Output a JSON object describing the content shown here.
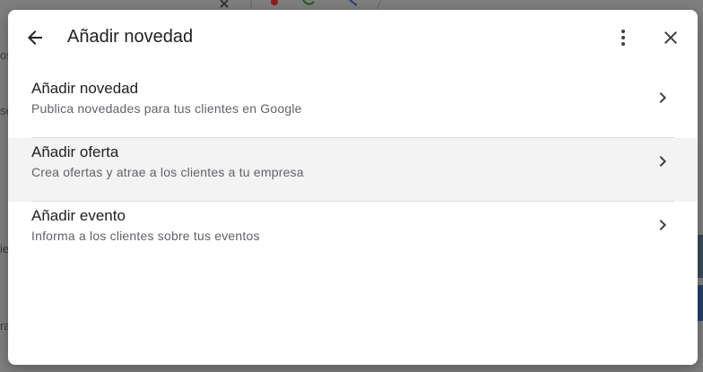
{
  "dialog": {
    "title": "Añadir novedad",
    "items": [
      {
        "title": "Añadir novedad",
        "subtitle": "Publica novedades para tus clientes en Google"
      },
      {
        "title": "Añadir oferta",
        "subtitle": "Crea ofertas y atrae a los clientes a tu empresa"
      },
      {
        "title": "Añadir evento",
        "subtitle": "Informa a los clientes sobre tus eventos"
      }
    ]
  },
  "background": {
    "fragments": [
      "os",
      "se",
      "ie",
      "ra"
    ]
  },
  "colors": {
    "text_primary": "#202124",
    "text_secondary": "#5f6368",
    "highlight": "#f3f3f3",
    "divider": "#dadce0"
  },
  "icons": {
    "back": "arrow-back-icon",
    "more": "more-vert-icon",
    "close": "close-icon",
    "chevron": "chevron-right-icon"
  }
}
